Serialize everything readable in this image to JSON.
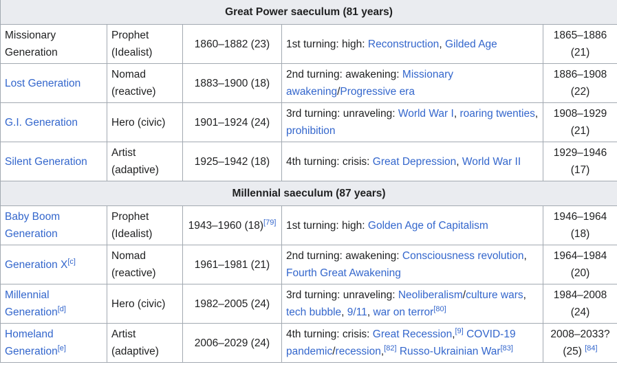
{
  "sections": [
    {
      "title": "Great Power saeculum (81 years)",
      "rows": [
        {
          "generation": [
            {
              "text": "Missionary Generation"
            }
          ],
          "archetype": "Prophet (Idealist)",
          "birth_years": [
            {
              "text": "1860–1882 (23)"
            }
          ],
          "turning": [
            {
              "text": "1st turning: high: "
            },
            {
              "text": "Reconstruction",
              "link": true
            },
            {
              "text": ", "
            },
            {
              "text": "Gilded Age",
              "link": true
            }
          ],
          "turning_years": [
            {
              "text": "1865–1886 (21)"
            }
          ]
        },
        {
          "generation": [
            {
              "text": "Lost Generation",
              "link": true
            }
          ],
          "archetype": "Nomad (reactive)",
          "birth_years": [
            {
              "text": "1883–1900 (18)"
            }
          ],
          "turning": [
            {
              "text": "2nd turning: awakening: "
            },
            {
              "text": "Missionary awakening",
              "link": true
            },
            {
              "text": "/"
            },
            {
              "text": "Progressive era",
              "link": true
            }
          ],
          "turning_years": [
            {
              "text": "1886–1908 (22)"
            }
          ]
        },
        {
          "generation": [
            {
              "text": "G.I. Generation",
              "link": true
            }
          ],
          "archetype": "Hero (civic)",
          "birth_years": [
            {
              "text": "1901–1924 (24)"
            }
          ],
          "turning": [
            {
              "text": "3rd turning: unraveling: "
            },
            {
              "text": "World War I",
              "link": true
            },
            {
              "text": ", "
            },
            {
              "text": "roaring twenties",
              "link": true
            },
            {
              "text": ", "
            },
            {
              "text": "prohibition",
              "link": true
            }
          ],
          "turning_years": [
            {
              "text": "1908–1929 (21)"
            }
          ]
        },
        {
          "generation": [
            {
              "text": "Silent Generation",
              "link": true
            }
          ],
          "archetype": "Artist (adaptive)",
          "birth_years": [
            {
              "text": "1925–1942 (18)"
            }
          ],
          "turning": [
            {
              "text": "4th turning: crisis: "
            },
            {
              "text": "Great Depression",
              "link": true
            },
            {
              "text": ", "
            },
            {
              "text": "World War II",
              "link": true
            }
          ],
          "turning_years": [
            {
              "text": "1929–1946 (17)"
            }
          ]
        }
      ]
    },
    {
      "title": "Millennial saeculum (87 years)",
      "rows": [
        {
          "generation": [
            {
              "text": "Baby Boom Generation",
              "link": true
            }
          ],
          "archetype": "Prophet (Idealist)",
          "birth_years": [
            {
              "text": "1943–1960 (18)"
            },
            {
              "text": "[79]",
              "sup": true,
              "link": true
            }
          ],
          "turning": [
            {
              "text": "1st turning: high: "
            },
            {
              "text": "Golden Age of Capitalism",
              "link": true
            }
          ],
          "turning_years": [
            {
              "text": "1946–1964 (18)"
            }
          ]
        },
        {
          "generation": [
            {
              "text": "Generation X",
              "link": true
            },
            {
              "text": "[c]",
              "sup": true,
              "link": true
            }
          ],
          "archetype": "Nomad (reactive)",
          "birth_years": [
            {
              "text": "1961–1981 (21)"
            }
          ],
          "turning": [
            {
              "text": "2nd turning: awakening: "
            },
            {
              "text": "Consciousness revolution",
              "link": true
            },
            {
              "text": ", "
            },
            {
              "text": "Fourth Great Awakening",
              "link": true
            }
          ],
          "turning_years": [
            {
              "text": "1964–1984 (20)"
            }
          ]
        },
        {
          "generation": [
            {
              "text": "Millennial Generation",
              "link": true
            },
            {
              "text": "[d]",
              "sup": true,
              "link": true
            }
          ],
          "archetype": "Hero (civic)",
          "birth_years": [
            {
              "text": "1982–2005 (24)"
            }
          ],
          "turning": [
            {
              "text": "3rd turning: unraveling: "
            },
            {
              "text": "Neoliberalism",
              "link": true
            },
            {
              "text": "/"
            },
            {
              "text": "culture wars",
              "link": true
            },
            {
              "text": ", "
            },
            {
              "text": "tech bubble",
              "link": true
            },
            {
              "text": ", "
            },
            {
              "text": "9/11",
              "link": true
            },
            {
              "text": ", "
            },
            {
              "text": "war on terror",
              "link": true
            },
            {
              "text": "[80]",
              "sup": true,
              "link": true
            }
          ],
          "turning_years": [
            {
              "text": "1984–2008 (24)"
            }
          ]
        },
        {
          "generation": [
            {
              "text": "Homeland Generation",
              "link": true
            },
            {
              "text": "[e]",
              "sup": true,
              "link": true
            }
          ],
          "archetype": "Artist (adaptive)",
          "birth_years": [
            {
              "text": "2006–2029 (24)"
            }
          ],
          "turning": [
            {
              "text": "4th turning: crisis: "
            },
            {
              "text": "Great Recession",
              "link": true
            },
            {
              "text": ",",
              "link": false
            },
            {
              "text": "[9]",
              "sup": true,
              "link": true
            },
            {
              "text": " "
            },
            {
              "text": "COVID-19 pandemic",
              "link": true
            },
            {
              "text": "/"
            },
            {
              "text": "recession",
              "link": true
            },
            {
              "text": ","
            },
            {
              "text": "[82]",
              "sup": true,
              "link": true
            },
            {
              "text": " "
            },
            {
              "text": "Russo-Ukrainian War",
              "link": true
            },
            {
              "text": "[83]",
              "sup": true,
              "link": true
            }
          ],
          "turning_years": [
            {
              "text": "2008–2033? (25) "
            },
            {
              "text": "[84]",
              "sup": true,
              "link": true
            }
          ]
        }
      ]
    }
  ]
}
